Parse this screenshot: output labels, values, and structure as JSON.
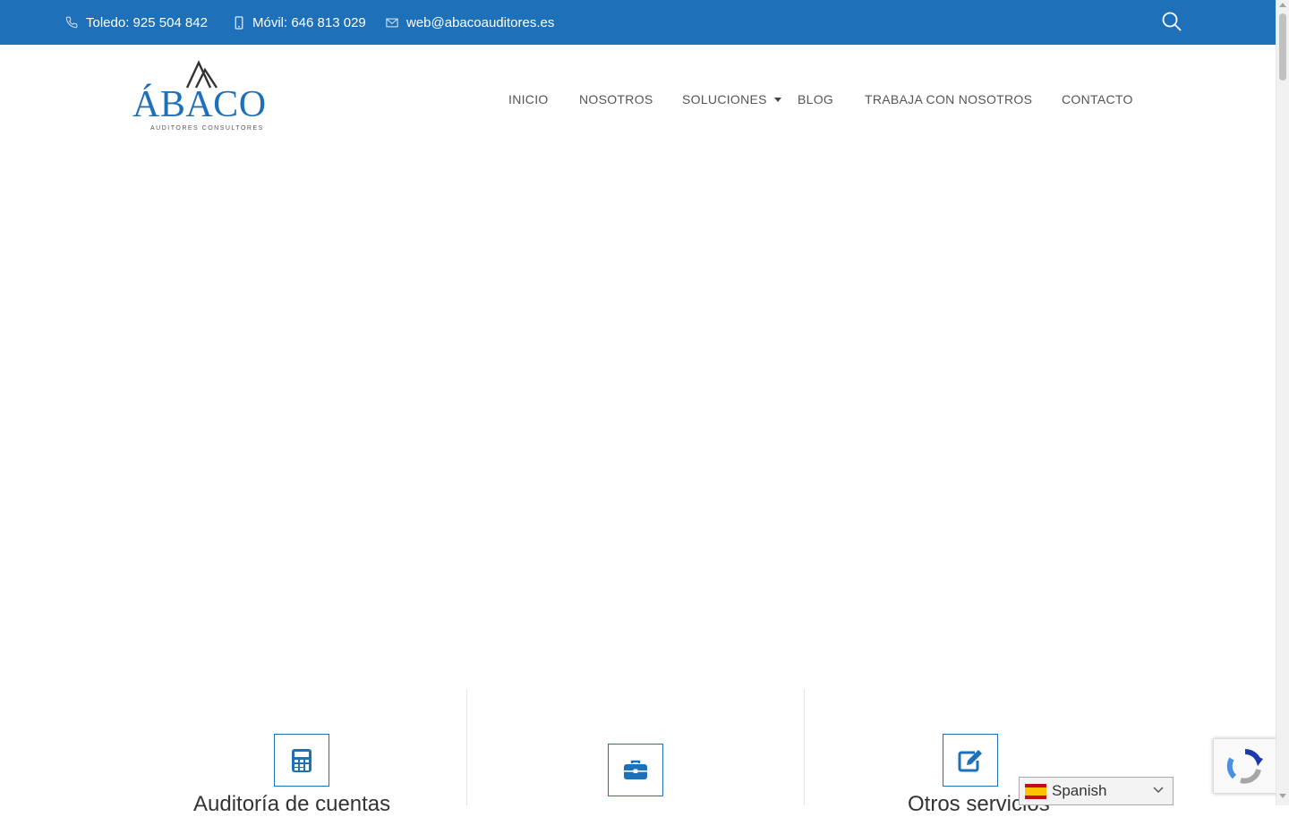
{
  "colors": {
    "brand_blue": "#1e70b8",
    "topbar_text": "#ffffff",
    "nav_text": "#555555"
  },
  "topbar": {
    "phone_icon": "phone-icon",
    "phone": "Toledo: 925 504 842",
    "mobile_icon": "mobile-icon",
    "mobile": "Móvil: 646 813 029",
    "email_icon": "mail-icon",
    "email": "web@abacoauditores.es",
    "search_icon": "search-icon"
  },
  "logo": {
    "name": "ÁBACO",
    "tagline": "AUDITORES CONSULTORES"
  },
  "nav": {
    "items": [
      {
        "label": "INICIO"
      },
      {
        "label": "NOSOTROS"
      },
      {
        "label": "SOLUCIONES",
        "has_dropdown": true
      },
      {
        "label": "BLOG"
      },
      {
        "label": "TRABAJA CON NOSOTROS"
      },
      {
        "label": "CONTACTO"
      }
    ]
  },
  "features": [
    {
      "icon": "calculator-icon",
      "title": "Auditoría de cuentas"
    },
    {
      "icon": "briefcase-icon",
      "title": ""
    },
    {
      "icon": "edit-icon",
      "title": "Otros servicios"
    }
  ],
  "language": {
    "flag": "spain-flag-icon",
    "selected": "Spanish"
  },
  "recaptcha": {
    "icon": "recaptcha-icon"
  }
}
